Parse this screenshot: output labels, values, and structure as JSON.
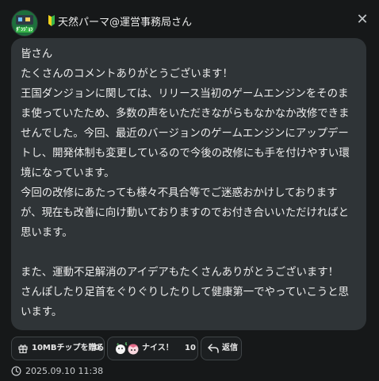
{
  "post": {
    "username": "天然パーマ@運営事務局さん",
    "message": "皆さん\nたくさんのコメントありがとうございます！\n王国ダンジョンに関しては、リリース当初のゲームエンジンをそのま\nま使っていたため、多数の声をいただきながらもなかなか改修できま\nせんでした。今回、最近のバージョンのゲームエンジンにアップデー\nトし、開発体制も変更しているので今後の改修にも手を付けやすい環\n境になっています。\n今回の改修にあたっても様々不具合等でご迷惑おかけしております\nが、現在も改善に向け動いておりますのでお付き合いいただければと\n思います。\n\nまた、運動不足解消のアイデアもたくさんありがとうございます！\nさんぽしたり足首をぐりぐりしたりして健康第一でやっていこうと思\nいます。",
    "timestamp": "2025.09.10 11:38"
  },
  "avatar": {
    "label": "ﾀﾞﾝｼﾞｮﾝ"
  },
  "actions": {
    "gift_label": "10MBチップを贈る",
    "gift_count": "0",
    "nice_label": "ナイス！",
    "nice_count": "10",
    "reply_label": "返信"
  },
  "icons": {
    "close": "close-icon",
    "gift": "gift-icon",
    "nice": "nice-reaction-icon",
    "reply": "reply-icon",
    "clock": "clock-icon",
    "beginner": "beginner-mark-icon"
  },
  "colors": {
    "background": "#161819",
    "bubble": "#2f3437",
    "pill_border": "#3f4447",
    "beginner_green": "#3bb54a",
    "beginner_yellow": "#f2d21b"
  }
}
